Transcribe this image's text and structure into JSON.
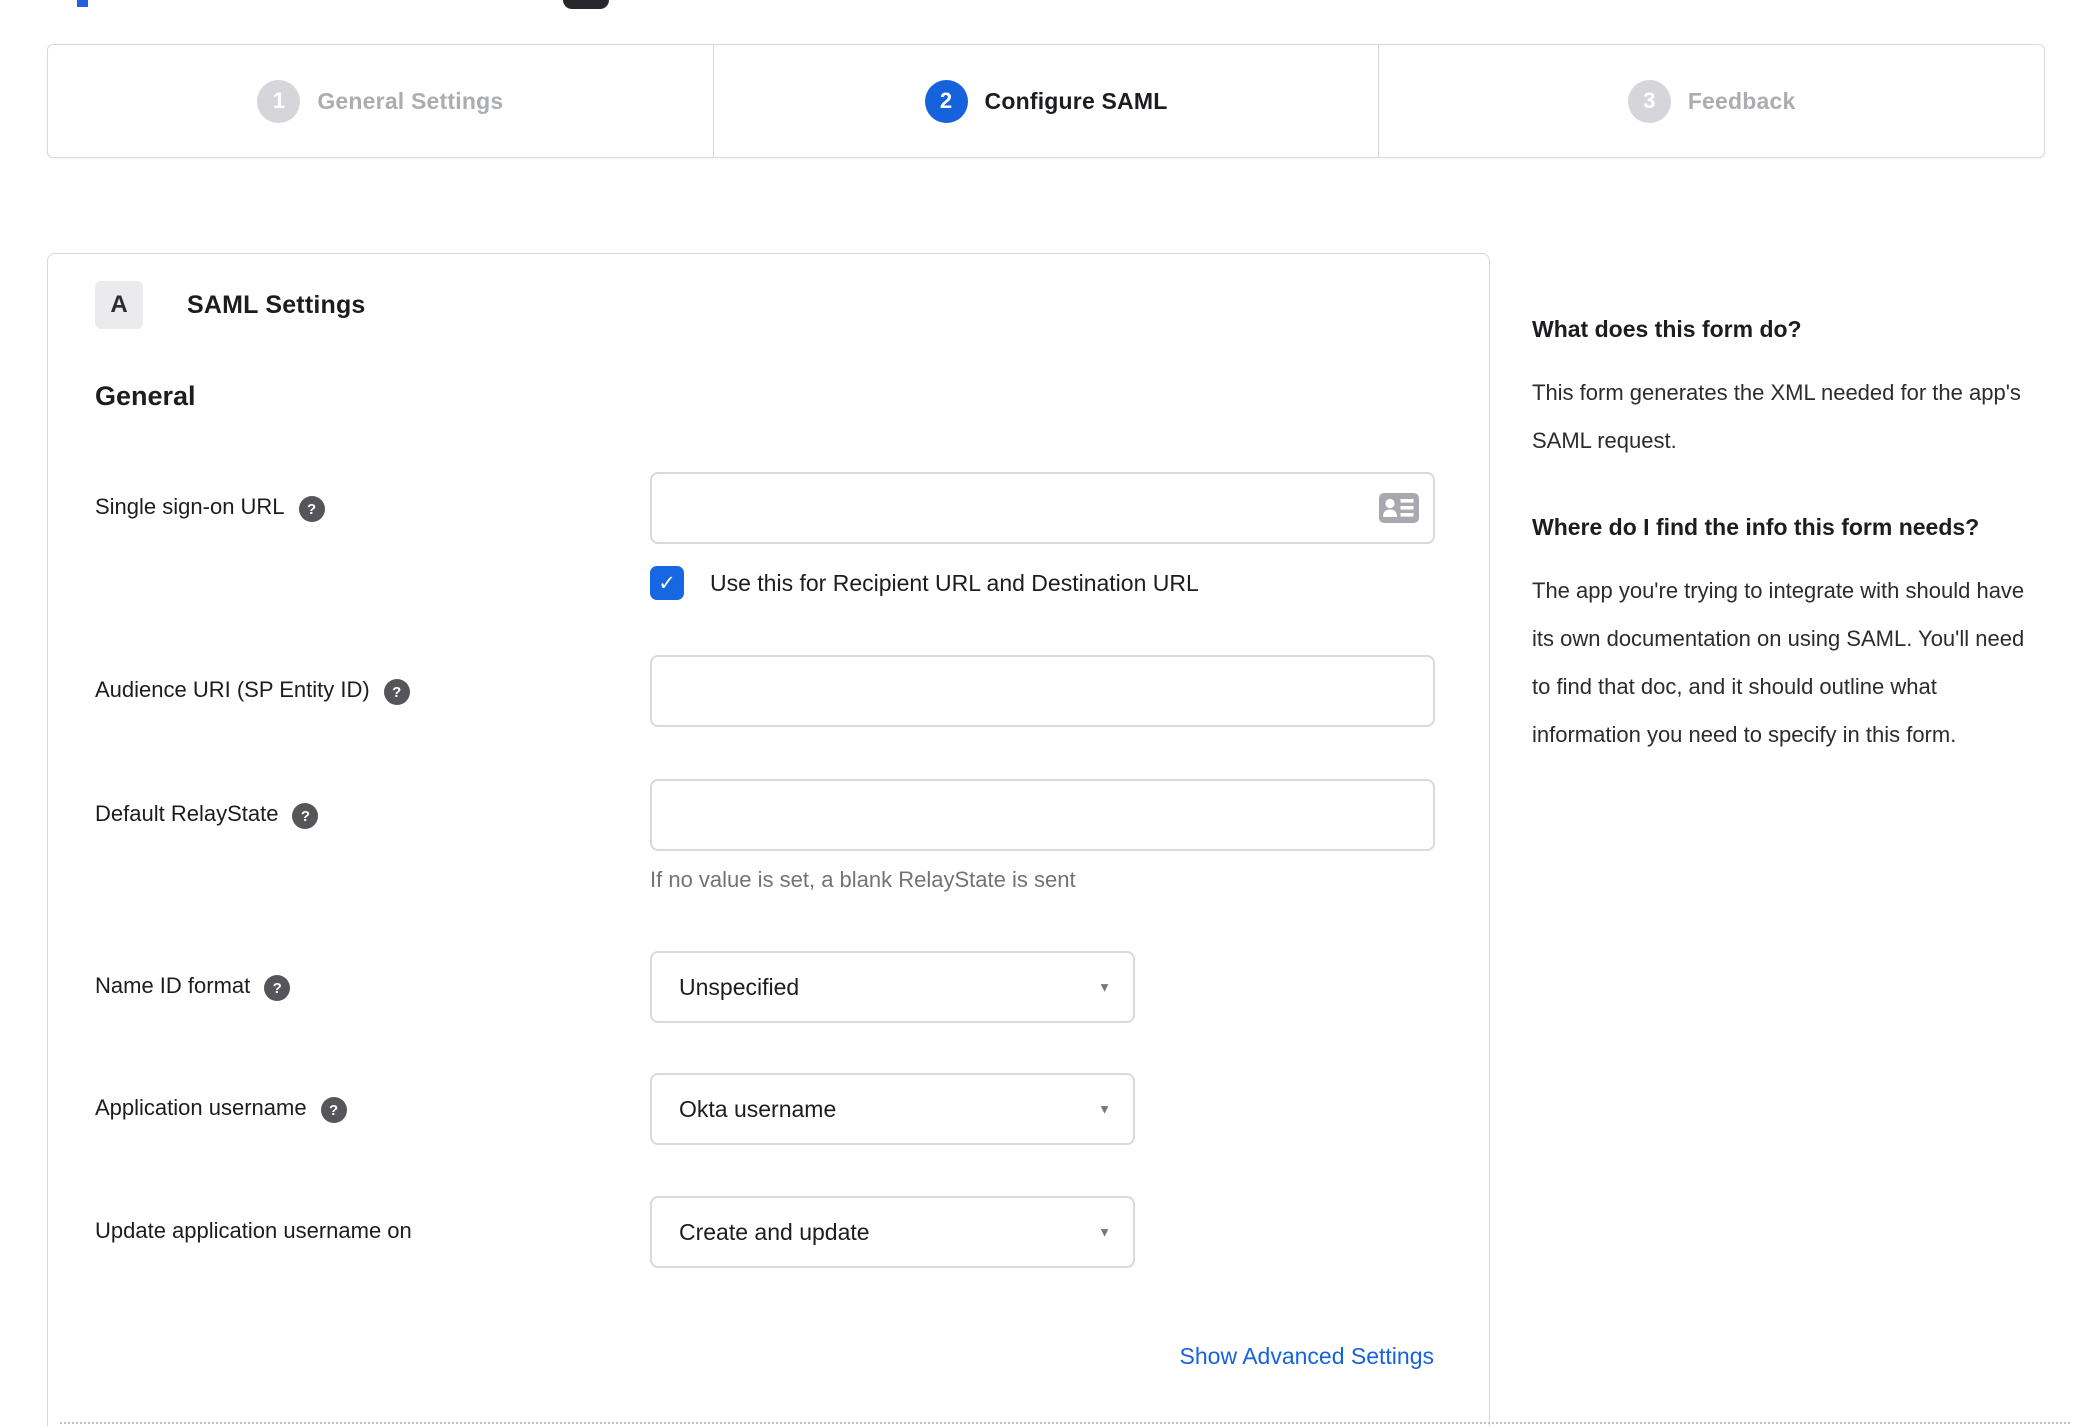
{
  "colors": {
    "accent_blue": "#1662dd",
    "checkbox_blue": "#1767e2",
    "inactive_gray": "#d6d6da",
    "border_gray": "#d9d9dd",
    "hint_gray": "#72727a"
  },
  "icons": {
    "help_glyph": "?",
    "check_glyph": "✓",
    "caret_glyph": "▼"
  },
  "stepper": {
    "steps": [
      {
        "number": "1",
        "label": "General Settings",
        "state": "inactive"
      },
      {
        "number": "2",
        "label": "Configure SAML",
        "state": "active"
      },
      {
        "number": "3",
        "label": "Feedback",
        "state": "inactive"
      }
    ]
  },
  "panel": {
    "section_badge": "A",
    "section_title": "SAML Settings",
    "group_heading": "General",
    "fields": [
      {
        "label": "Single sign-on URL",
        "type": "text",
        "value": "",
        "checkbox_label": "Use this for Recipient URL and Destination URL",
        "checkbox_checked": true
      },
      {
        "label": "Audience URI (SP Entity ID)",
        "type": "text",
        "value": ""
      },
      {
        "label": "Default RelayState",
        "type": "text",
        "value": "",
        "hint": "If no value is set, a blank RelayState is sent"
      },
      {
        "label": "Name ID format",
        "type": "select",
        "value": "Unspecified"
      },
      {
        "label": "Application username",
        "type": "select",
        "value": "Okta username"
      },
      {
        "label": "Update application username on",
        "type": "select",
        "value": "Create and update"
      }
    ],
    "advanced_link": "Show Advanced Settings"
  },
  "help": {
    "heading_1": "What does this form do?",
    "para_1": "This form generates the XML needed for the app's SAML request.",
    "heading_2": "Where do I find the info this form needs?",
    "para_2": "The app you're trying to integrate with should have its own documentation on using SAML. You'll need to find that doc, and it should outline what information you need to specify in this form."
  }
}
